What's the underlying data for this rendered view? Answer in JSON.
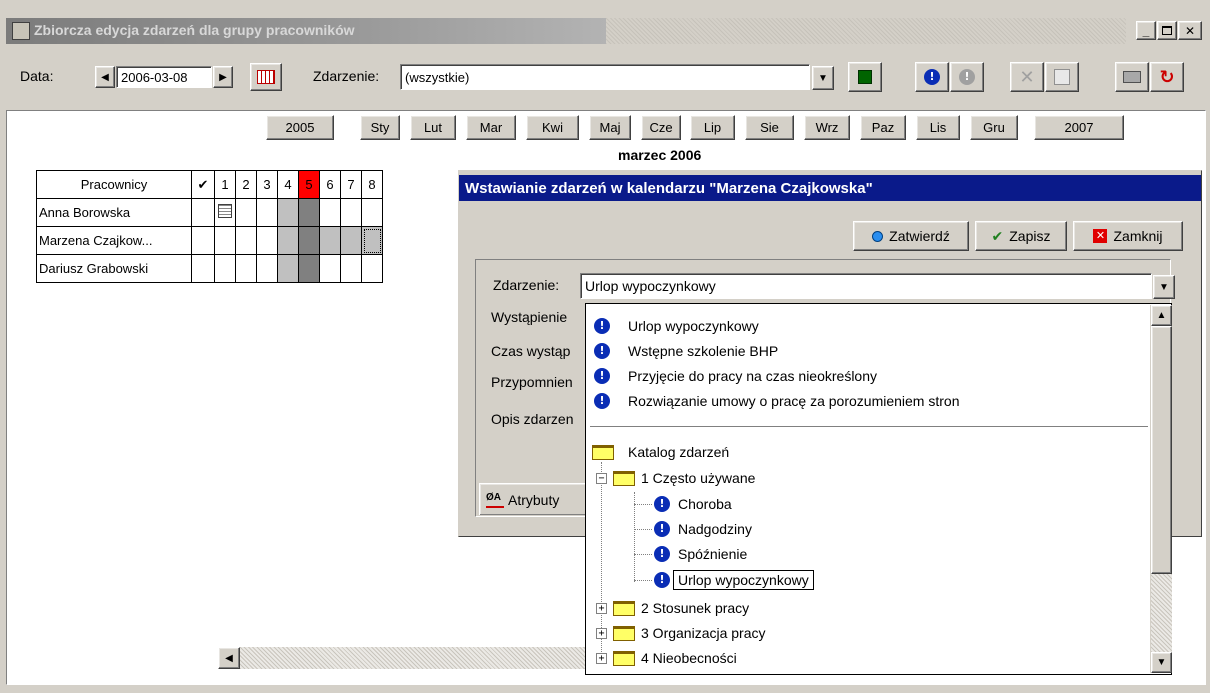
{
  "window": {
    "title": "Zbiorcza edycja zdarzeń dla grupy pracowników"
  },
  "toolbar": {
    "date_label": "Data:",
    "date_value": "2006-03-08",
    "event_label": "Zdarzenie:",
    "event_value": "(wszystkie)"
  },
  "months": {
    "prev_year": "2005",
    "items": [
      "Sty",
      "Lut",
      "Mar",
      "Kwi",
      "Maj",
      "Cze",
      "Lip",
      "Sie",
      "Wrz",
      "Paz",
      "Lis",
      "Gru"
    ],
    "next_year": "2007",
    "caption": "marzec 2006"
  },
  "grid": {
    "header": "Pracownicy",
    "check": "✔",
    "days": [
      "1",
      "2",
      "3",
      "4",
      "5",
      "6",
      "7",
      "8"
    ],
    "employees": [
      "Anna Borowska",
      "Marzena Czajkow...",
      "Dariusz Grabowski"
    ]
  },
  "dialog": {
    "title": "Wstawianie zdarzeń w kalendarzu \"Marzena Czajkowska\"",
    "confirm": "Zatwierdź",
    "save": "Zapisz",
    "close": "Zamknij",
    "event_label": "Zdarzenie:",
    "event_value": "Urlop wypoczynkowy",
    "labels": [
      "Wystąpienie",
      "Czas wystąp",
      "Przypomnien",
      "Opis zdarzen"
    ],
    "tab_label": "Atrybuty"
  },
  "dropdown": {
    "recent": [
      "Urlop wypoczynkowy",
      "Wstępne szkolenie BHP",
      "Przyjęcie do pracy na czas nieokreślony",
      "Rozwiązanie umowy o pracę za porozumieniem stron"
    ],
    "catalog": "Katalog zdarzeń",
    "folder1": "1 Często używane",
    "children": [
      "Choroba",
      "Nadgodziny",
      "Spóźnienie",
      "Urlop wypoczynkowy"
    ],
    "folder2": "2 Stosunek pracy",
    "folder3": "3 Organizacja pracy",
    "folder4": "4 Nieobecności"
  }
}
